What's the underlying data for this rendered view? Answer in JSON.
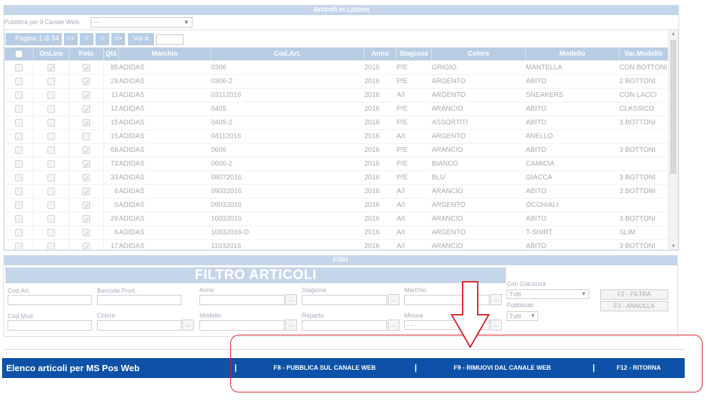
{
  "articoli": {
    "title": "Articoli in Listino",
    "publish_label": "Pubblica per il Canale Web:",
    "publish_value": "---",
    "pager": {
      "page_text": "Pagina 1 di 54",
      "first": "<<",
      "prev": "<",
      "next": ">",
      "last": ">>",
      "goto_label": "Vai a",
      "goto_value": ""
    },
    "columns": [
      "",
      "OnLine",
      "Foto",
      "Qtà",
      "Marchio",
      "Cod.Art.",
      "Anno",
      "Stagione",
      "Colore",
      "Modello",
      "Var.Modello"
    ],
    "rows": [
      {
        "online": true,
        "foto": true,
        "qta": "85",
        "marchio": "ADIDAS",
        "cod": "0306",
        "anno": "2016",
        "stagione": "P/E",
        "colore": "GRIGIO",
        "modello": "MANTELLA",
        "var": "CON BOTTONI"
      },
      {
        "online": false,
        "foto": true,
        "qta": "29",
        "marchio": "ADIDAS",
        "cod": "0306-2",
        "anno": "2016",
        "stagione": "P/E",
        "colore": "ARGENTO",
        "modello": "ABITO",
        "var": "2 BOTTONI"
      },
      {
        "online": false,
        "foto": true,
        "qta": "11",
        "marchio": "ADIDAS",
        "cod": "03112016",
        "anno": "2016",
        "stagione": "A/I",
        "colore": "ARGENTO",
        "modello": "SNEAKERS",
        "var": "CON LACCI"
      },
      {
        "online": false,
        "foto": true,
        "qta": "12",
        "marchio": "ADIDAS",
        "cod": "0405",
        "anno": "2016",
        "stagione": "P/E",
        "colore": "ARANCIO",
        "modello": "ABITO",
        "var": "CLASSICO"
      },
      {
        "online": false,
        "foto": true,
        "qta": "15",
        "marchio": "ADIDAS",
        "cod": "0405-2",
        "anno": "2016",
        "stagione": "P/E",
        "colore": "ASSORTITI",
        "modello": "ABITO",
        "var": "3 BOTTONI"
      },
      {
        "online": false,
        "foto": false,
        "qta": "15",
        "marchio": "ADIDAS",
        "cod": "04112016",
        "anno": "2016",
        "stagione": "A/I",
        "colore": "ARGENTO",
        "modello": "ANELLO",
        "var": ""
      },
      {
        "online": false,
        "foto": true,
        "qta": "68",
        "marchio": "ADIDAS",
        "cod": "0606",
        "anno": "2016",
        "stagione": "P/E",
        "colore": "ARANCIO",
        "modello": "ABITO",
        "var": "3 BOTTONI"
      },
      {
        "online": false,
        "foto": true,
        "qta": "73",
        "marchio": "ADIDAS",
        "cod": "0606-2",
        "anno": "2016",
        "stagione": "P/E",
        "colore": "BIANCO",
        "modello": "CAMICIA",
        "var": ""
      },
      {
        "online": false,
        "foto": true,
        "qta": "33",
        "marchio": "ADIDAS",
        "cod": "08072016",
        "anno": "2016",
        "stagione": "P/E",
        "colore": "BLU",
        "modello": "GIACCA",
        "var": "3 BOTTONI"
      },
      {
        "online": false,
        "foto": true,
        "qta": "6",
        "marchio": "ADIDAS",
        "cod": "09032016",
        "anno": "2016",
        "stagione": "A/I",
        "colore": "ARANCIO",
        "modello": "ABITO",
        "var": "3 BOTTONI"
      },
      {
        "online": false,
        "foto": true,
        "qta": "0",
        "marchio": "ADIDAS",
        "cod": "09032016",
        "anno": "2016",
        "stagione": "A/I",
        "colore": "ARGENTO",
        "modello": "OCCHIALI",
        "var": ""
      },
      {
        "online": false,
        "foto": true,
        "qta": "29",
        "marchio": "ADIDAS",
        "cod": "10032016",
        "anno": "2016",
        "stagione": "A/I",
        "colore": "ARANCIO",
        "modello": "ABITO",
        "var": "3 BOTTONI"
      },
      {
        "online": false,
        "foto": true,
        "qta": "6",
        "marchio": "ADIDAS",
        "cod": "10032016-D",
        "anno": "2016",
        "stagione": "A/I",
        "colore": "ARGENTO",
        "modello": "T-SHIRT",
        "var": "SLIM"
      },
      {
        "online": false,
        "foto": true,
        "qta": "17",
        "marchio": "ADIDAS",
        "cod": "11032016",
        "anno": "2016",
        "stagione": "A/I",
        "colore": "ARANCIO",
        "modello": "ABITO",
        "var": "3 BOTTONI"
      }
    ]
  },
  "filtri": {
    "title": "Filtri",
    "big_title": "FILTRO ARTICOLI",
    "labels": {
      "cod_art": "Cod.Art.",
      "barcode": "Barcode Prod.",
      "anno": "Anno",
      "stagione": "Stagione",
      "marchio": "Marchio",
      "cod_mod": "Cod.Mod.",
      "colore": "Colore",
      "modello": "Modello",
      "reparto": "Reparto",
      "misura": "Misura",
      "con_giacenza": "Con Giacenza",
      "pubblicati": "Pubblicati"
    },
    "dots": "...",
    "misura_value": "- - -",
    "con_giacenza_value": "Tutti",
    "pubblicati_value": "Tutti",
    "btn_filtra": "F2 - FILTRA",
    "btn_annulla": "F3 - ANNULLA"
  },
  "bottom_bar": {
    "title": "Elenco articoli per MS Pos Web",
    "separator": "|",
    "btn_publish": "F8 - PUBBLICA SUL CANALE WEB",
    "btn_remove": "F9 - RIMUOVI DAL CANALE WEB",
    "btn_return": "F12 - RITORNA"
  },
  "colors": {
    "header_blue": "#b8cde4",
    "bottom_bar_blue": "#0d52a8",
    "annotation_red": "#d9212b"
  }
}
